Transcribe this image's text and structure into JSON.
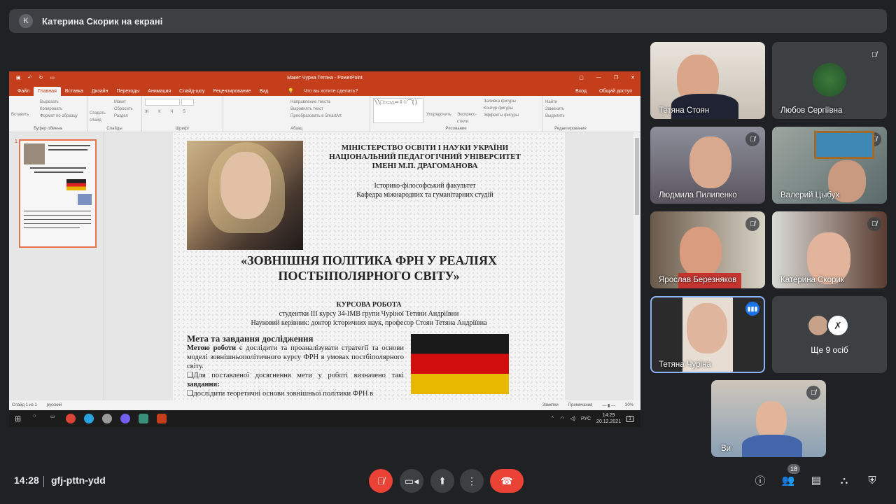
{
  "topbar": {
    "avatar_letter": "K",
    "title": "Катерина Скорик на екрані"
  },
  "powerpoint": {
    "doc_title": "Макет Чурна Тетяна - PowerPoint",
    "tabs": [
      "Файл",
      "Главная",
      "Вставка",
      "Дизайн",
      "Переходы",
      "Анимация",
      "Слайд-шоу",
      "Рецензирование",
      "Вид"
    ],
    "active_tab": "Главная",
    "tell_me": "Что вы хотите сделать?",
    "sign_in": "Вход",
    "share": "Общий доступ",
    "groups": {
      "clipboard": {
        "label": "Буфер обмена",
        "paste": "Вставить",
        "cut": "Вырезать",
        "copy": "Копировать",
        "format": "Формат по образцу"
      },
      "slides": {
        "label": "Слайды",
        "new": "Создать слайд",
        "layout": "Макет",
        "reset": "Сбросить",
        "section": "Раздел"
      },
      "font": {
        "label": "Шрифт"
      },
      "paragraph": {
        "label": "Абзац",
        "dir": "Направление текста",
        "align": "Выровнять текст",
        "smartart": "Преобразовать в SmartArt"
      },
      "drawing": {
        "label": "Рисование",
        "arrange": "Упорядочить",
        "styles": "Экспресс-стили",
        "fill": "Заливка фигуры",
        "outline": "Контур фигуры",
        "effects": "Эффекты фигуры"
      },
      "editing": {
        "label": "Редактирование",
        "find": "Найти",
        "replace": "Заменить",
        "select": "Выделить"
      }
    },
    "slide_number": "1",
    "status": {
      "slide": "Слайд 1 из 1",
      "lang": "русский",
      "notes": "Заметки",
      "comments": "Примечания",
      "zoom": "30%"
    },
    "taskbar": {
      "lang": "РУС",
      "time": "14:29",
      "date": "20.12.2021",
      "notif": "1"
    }
  },
  "slide": {
    "header": [
      "МІНІСТЕРСТВО ОСВІТИ І НАУКИ УКРАЇНИ",
      "НАЦІОНАЛЬНИЙ ПЕДАГОГІЧНИЙ УНІВЕРСИТЕТ",
      "ІМЕНІ М.П. ДРАГОМАНОВА"
    ],
    "faculty": "Історико-філософський факультет",
    "department": "Кафедра міжнародних та гуманітарних студій",
    "title_line1": "«ЗОВНІШНЯ ПОЛІТИКА ФРН У РЕАЛІЯХ",
    "title_line2": "ПОСТБІПОЛЯРНОГО СВІТУ»",
    "work_type": "КУРСОВА РОБОТА",
    "student": "студентки ІІІ курсу 34-ІМВ групи Чуріної Тетяни Андріївни",
    "supervisor": "Науковий керівник: доктор історичних наук, професор Стоян Тетяна Андріївна",
    "section_head": "Мета та завдання дослідження",
    "goal_bold": "Метою роботи",
    "goal_text": " є дослідити та проаналізувати стратегії та основи моделі зовнішньополітичного курсу ФРН в умовах постбіполярного світу.",
    "tasks_intro": "❑Для поставленої досягнення мети у роботі визначено такі ",
    "tasks_bold": "завдання:",
    "task1": "❑дослідити теоретичні основи зовнішньої політики ФРН в"
  },
  "participants": [
    {
      "name": "Тетяна Стоян",
      "muted": false
    },
    {
      "name": "Любов Сергіївна",
      "muted": true
    },
    {
      "name": "Людмила Пилипенко",
      "muted": true
    },
    {
      "name": "Валерий Цыбух",
      "muted": true
    },
    {
      "name": "Ярослав Березняков",
      "muted": true
    },
    {
      "name": "Катерина Скорик",
      "muted": true
    },
    {
      "name": "Тетяна Чуріна",
      "muted": false,
      "speaking": true
    },
    {
      "name": "Ще 9 осіб"
    },
    {
      "name": "Ви",
      "muted": true
    }
  ],
  "bottom": {
    "time": "14:28",
    "meeting_code": "gfj-pttn-ydd",
    "people_count": "18"
  }
}
